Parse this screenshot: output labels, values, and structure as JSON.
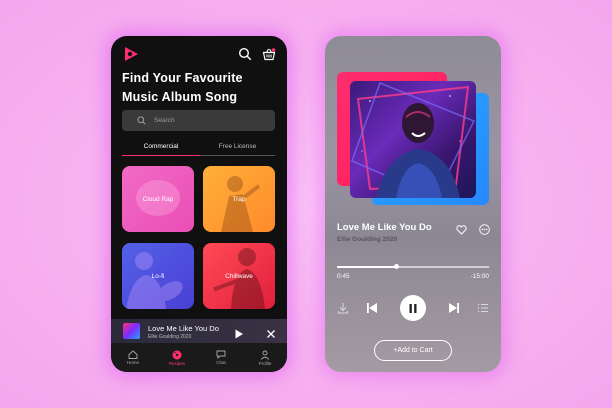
{
  "colors": {
    "background": "#f8b6f3",
    "accent_pink": "#ff2f6e",
    "accent_blue": "#28a7ff",
    "dark_surface": "#101010"
  },
  "home": {
    "header": {
      "logo_icon": "play-logo-icon",
      "search_icon": "search-icon",
      "basket_icon": "basket-icon"
    },
    "title": "Find Your Favourite Music Album Song",
    "search": {
      "placeholder": "Search"
    },
    "tabs": [
      {
        "label": "Commercial",
        "active": true
      },
      {
        "label": "Free License",
        "active": false
      }
    ],
    "genres": [
      {
        "label": "Cloud Rap",
        "color": "#f26ac6"
      },
      {
        "label": "Trap",
        "color": "#ffb03a"
      },
      {
        "label": "Lo-fi",
        "color": "#5361e6"
      },
      {
        "label": "Chillwave",
        "color": "#ff4a55"
      }
    ],
    "mini_player": {
      "title": "Love Me Like You Do",
      "artist": "Ellie Goulding 2020"
    },
    "nav": [
      {
        "label": "Home",
        "icon": "home-icon",
        "active": false
      },
      {
        "label": "Recipes",
        "icon": "disc-icon",
        "active": true
      },
      {
        "label": "Chat",
        "icon": "chat-icon",
        "active": false
      },
      {
        "label": "Profile",
        "icon": "profile-icon",
        "active": false
      }
    ]
  },
  "player": {
    "title": "Love Me Like You Do",
    "artist": "Ellie Goulding 2020",
    "elapsed": "0:45",
    "remaining": "-15:00",
    "progress": 0.39,
    "cart_label": "+Add to Cart"
  }
}
